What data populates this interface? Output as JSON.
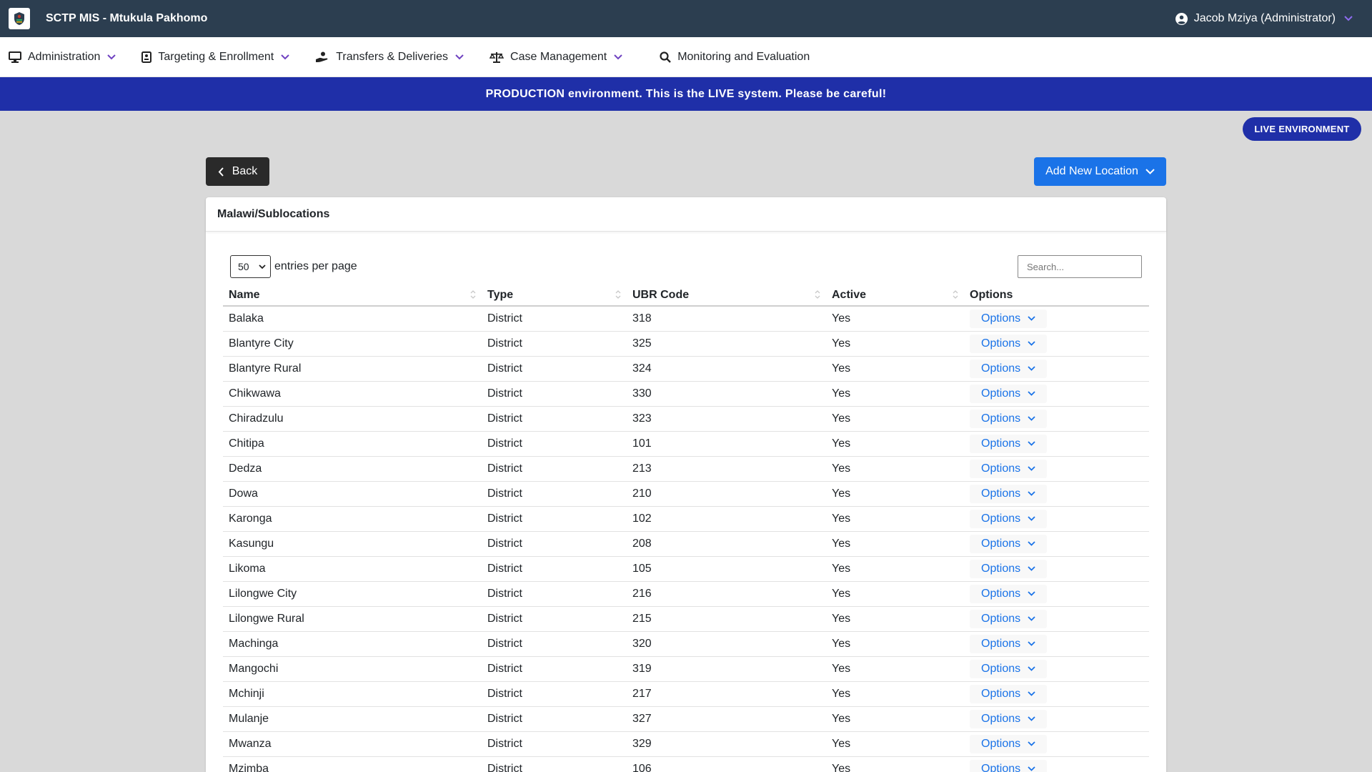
{
  "topbar": {
    "title": "SCTP MIS - Mtukula Pakhomo",
    "user": "Jacob Mziya (Administrator)"
  },
  "nav": [
    {
      "label": "Administration",
      "icon": "monitor-icon"
    },
    {
      "label": "Targeting & Enrollment",
      "icon": "id-card-icon"
    },
    {
      "label": "Transfers & Deliveries",
      "icon": "hand-coin-icon"
    },
    {
      "label": "Case Management",
      "icon": "scale-icon"
    },
    {
      "label": "Monitoring and Evaluation",
      "icon": "search-icon"
    }
  ],
  "banner": "PRODUCTION environment. This is the LIVE system. Please be careful!",
  "live_badge": "LIVE ENVIRONMENT",
  "back_label": "Back",
  "add_label": "Add New Location",
  "card_title": "Malawi/Sublocations",
  "entries": {
    "value": "50",
    "label": "entries per page"
  },
  "search_placeholder": "Search...",
  "columns": [
    "Name",
    "Type",
    "UBR Code",
    "Active",
    "Options"
  ],
  "rows": [
    {
      "name": "Balaka",
      "type": "District",
      "code": "318",
      "active": "Yes",
      "options": "Options"
    },
    {
      "name": "Blantyre City",
      "type": "District",
      "code": "325",
      "active": "Yes",
      "options": "Options"
    },
    {
      "name": "Blantyre Rural",
      "type": "District",
      "code": "324",
      "active": "Yes",
      "options": "Options"
    },
    {
      "name": "Chikwawa",
      "type": "District",
      "code": "330",
      "active": "Yes",
      "options": "Options"
    },
    {
      "name": "Chiradzulu",
      "type": "District",
      "code": "323",
      "active": "Yes",
      "options": "Options"
    },
    {
      "name": "Chitipa",
      "type": "District",
      "code": "101",
      "active": "Yes",
      "options": "Options"
    },
    {
      "name": "Dedza",
      "type": "District",
      "code": "213",
      "active": "Yes",
      "options": "Options"
    },
    {
      "name": "Dowa",
      "type": "District",
      "code": "210",
      "active": "Yes",
      "options": "Options"
    },
    {
      "name": "Karonga",
      "type": "District",
      "code": "102",
      "active": "Yes",
      "options": "Options"
    },
    {
      "name": "Kasungu",
      "type": "District",
      "code": "208",
      "active": "Yes",
      "options": "Options"
    },
    {
      "name": "Likoma",
      "type": "District",
      "code": "105",
      "active": "Yes",
      "options": "Options"
    },
    {
      "name": "Lilongwe City",
      "type": "District",
      "code": "216",
      "active": "Yes",
      "options": "Options"
    },
    {
      "name": "Lilongwe Rural",
      "type": "District",
      "code": "215",
      "active": "Yes",
      "options": "Options"
    },
    {
      "name": "Machinga",
      "type": "District",
      "code": "320",
      "active": "Yes",
      "options": "Options"
    },
    {
      "name": "Mangochi",
      "type": "District",
      "code": "319",
      "active": "Yes",
      "options": "Options"
    },
    {
      "name": "Mchinji",
      "type": "District",
      "code": "217",
      "active": "Yes",
      "options": "Options"
    },
    {
      "name": "Mulanje",
      "type": "District",
      "code": "327",
      "active": "Yes",
      "options": "Options"
    },
    {
      "name": "Mwanza",
      "type": "District",
      "code": "329",
      "active": "Yes",
      "options": "Options"
    },
    {
      "name": "Mzimba",
      "type": "District",
      "code": "106",
      "active": "Yes",
      "options": "Options"
    }
  ],
  "colors": {
    "topbar": "#2c3e50",
    "banner": "#1f2fa8",
    "accent": "#1a73e8",
    "chevron": "#6f42c1"
  }
}
